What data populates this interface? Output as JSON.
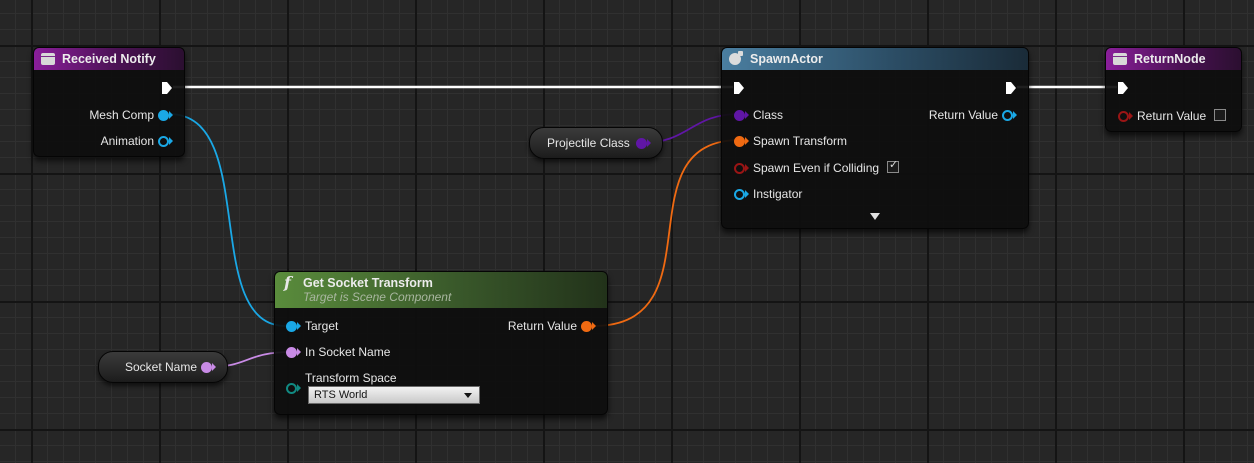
{
  "nodes": {
    "received_notify": {
      "title": "Received Notify",
      "pins": {
        "mesh_comp": "Mesh Comp",
        "animation": "Animation"
      }
    },
    "spawn_actor": {
      "title": "SpawnActor",
      "pins": {
        "class": "Class",
        "spawn_transform": "Spawn Transform",
        "spawn_even_if_colliding": "Spawn Even if Colliding",
        "instigator": "Instigator",
        "return_value": "Return Value"
      },
      "spawn_even_if_colliding_checked": true
    },
    "return_node": {
      "title": "ReturnNode",
      "pins": {
        "return_value": "Return Value"
      },
      "return_value_checked": false
    },
    "get_socket_transform": {
      "title": "Get Socket Transform",
      "subtitle": "Target is Scene Component",
      "icon": "f",
      "pins": {
        "target": "Target",
        "in_socket_name": "In Socket Name",
        "transform_space": "Transform Space",
        "return_value": "Return Value"
      },
      "transform_space_value": "RTS World"
    },
    "projectile_class": {
      "label": "Projectile Class"
    },
    "socket_name": {
      "label": "Socket Name"
    }
  },
  "colors": {
    "grid_background": "#262626",
    "event_header": "#8a1e9a",
    "spawn_header": "#4a7ea0",
    "function_header": "#5a8c3c",
    "exec_wire": "#ffffff",
    "object_pin": "#1aa8e6",
    "class_pin": "#6016a6",
    "transform_pin": "#f06a12",
    "bool_pin": "#9a1515",
    "name_pin": "#c98be6",
    "enum_pin": "#118a82"
  },
  "icons": {
    "event": "event-node-icon",
    "spawn": "spawn-actor-icon",
    "function": "function-icon"
  }
}
